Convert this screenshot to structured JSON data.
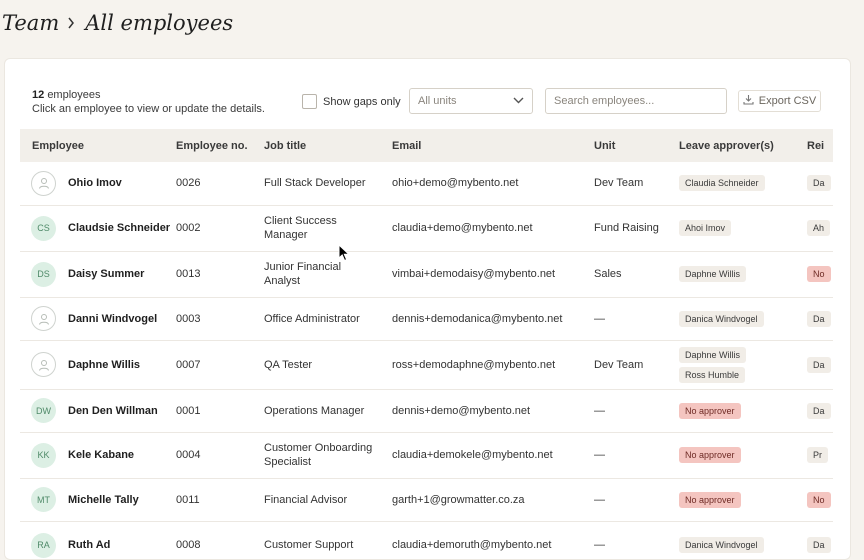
{
  "breadcrumb": {
    "parent": "Team",
    "current": "All employees"
  },
  "summary": {
    "count": "12",
    "count_suffix": "employees",
    "hint": "Click an employee to view or update the details."
  },
  "toolbar": {
    "show_gaps_label": "Show gaps only",
    "units_value": "All units",
    "search_placeholder": "Search employees...",
    "export_label": "Export CSV"
  },
  "table": {
    "columns": [
      "Employee",
      "Employee no.",
      "Job title",
      "Email",
      "Unit",
      "Leave approver(s)",
      "Rei"
    ],
    "rows": [
      {
        "avatar": "",
        "name": "Ohio Imov",
        "number": "0026",
        "job": [
          "Full Stack Developer"
        ],
        "email": "ohio+demo@mybento.net",
        "unit": "Dev Team",
        "approvers": [
          {
            "text": "Claudia Schneider",
            "warn": false
          }
        ],
        "extra": {
          "text": "Da",
          "warn": false
        }
      },
      {
        "avatar": "CS",
        "name": "Claudsie Schneider",
        "number": "0002",
        "job": [
          "Client Success",
          "Manager"
        ],
        "email": "claudia+demo@mybento.net",
        "unit": "Fund Raising",
        "approvers": [
          {
            "text": "Ahoi Imov",
            "warn": false
          }
        ],
        "extra": {
          "text": "Ah",
          "warn": false
        }
      },
      {
        "avatar": "DS",
        "name": "Daisy Summer",
        "number": "0013",
        "job": [
          "Junior Financial",
          "Analyst"
        ],
        "email": "vimbai+demodaisy@mybento.net",
        "unit": "Sales",
        "approvers": [
          {
            "text": "Daphne Willis",
            "warn": false
          }
        ],
        "extra": {
          "text": "No",
          "warn": true
        }
      },
      {
        "avatar": "",
        "name": "Danni Windvogel",
        "number": "0003",
        "job": [
          "Office Administrator"
        ],
        "email": "dennis+demodanica@mybento.net",
        "unit": "—",
        "approvers": [
          {
            "text": "Danica Windvogel",
            "warn": false
          }
        ],
        "extra": {
          "text": "Da",
          "warn": false
        }
      },
      {
        "avatar": "",
        "name": "Daphne Willis",
        "number": "0007",
        "job": [
          "QA Tester"
        ],
        "email": "ross+demodaphne@mybento.net",
        "unit": "Dev Team",
        "approvers": [
          {
            "text": "Daphne Willis",
            "warn": false
          },
          {
            "text": "Ross Humble",
            "warn": false
          }
        ],
        "extra": {
          "text": "Da",
          "warn": false
        }
      },
      {
        "avatar": "DW",
        "name": "Den Den Willman",
        "number": "0001",
        "job": [
          "Operations Manager"
        ],
        "email": "dennis+demo@mybento.net",
        "unit": "—",
        "approvers": [
          {
            "text": "No approver",
            "warn": true
          }
        ],
        "extra": {
          "text": "Da",
          "warn": false
        }
      },
      {
        "avatar": "KK",
        "name": "Kele Kabane",
        "number": "0004",
        "job": [
          "Customer Onboarding",
          "Specialist"
        ],
        "email": "claudia+demokele@mybento.net",
        "unit": "—",
        "approvers": [
          {
            "text": "No approver",
            "warn": true
          }
        ],
        "extra": {
          "text": "Pr",
          "warn": false
        }
      },
      {
        "avatar": "MT",
        "name": "Michelle Tally",
        "number": "0011",
        "job": [
          "Financial Advisor"
        ],
        "email": "garth+1@growmatter.co.za",
        "unit": "—",
        "approvers": [
          {
            "text": "No approver",
            "warn": true
          }
        ],
        "extra": {
          "text": "No",
          "warn": true
        }
      },
      {
        "avatar": "RA",
        "name": "Ruth Ad",
        "number": "0008",
        "job": [
          "Customer Support"
        ],
        "email": "claudia+demoruth@mybento.net",
        "unit": "—",
        "approvers": [
          {
            "text": "Danica Windvogel",
            "warn": false
          }
        ],
        "extra": {
          "text": "Da",
          "warn": false
        }
      }
    ]
  }
}
